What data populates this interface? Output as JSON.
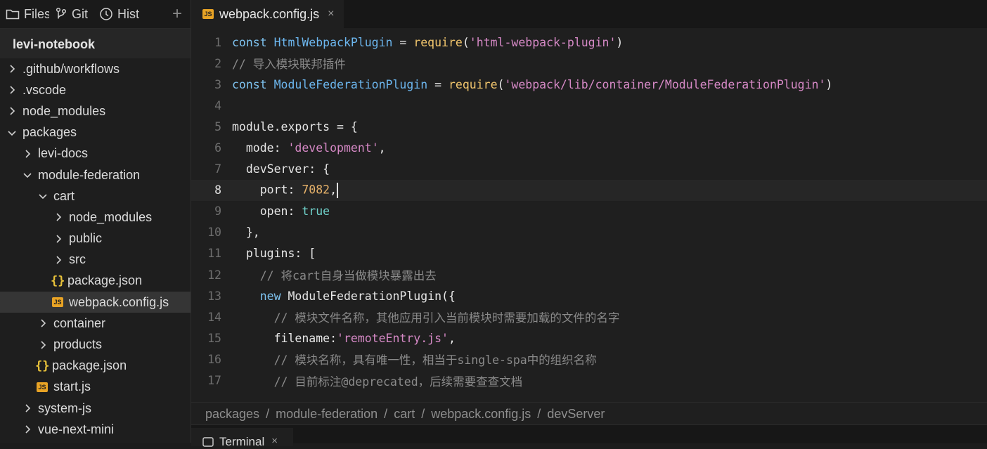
{
  "sidebar": {
    "tabs": [
      {
        "label": "Files",
        "icon": "folder-icon"
      },
      {
        "label": "Git",
        "icon": "git-branch-icon"
      },
      {
        "label": "Hist",
        "icon": "clock-icon"
      }
    ],
    "add_label": "+",
    "project": "levi-notebook",
    "tree": [
      {
        "label": ".github/workflows",
        "kind": "folder",
        "expanded": false,
        "depth": 0
      },
      {
        "label": ".vscode",
        "kind": "folder",
        "expanded": false,
        "depth": 0
      },
      {
        "label": "node_modules",
        "kind": "folder",
        "expanded": false,
        "depth": 0
      },
      {
        "label": "packages",
        "kind": "folder",
        "expanded": true,
        "depth": 0
      },
      {
        "label": "levi-docs",
        "kind": "folder",
        "expanded": false,
        "depth": 1
      },
      {
        "label": "module-federation",
        "kind": "folder",
        "expanded": true,
        "depth": 1
      },
      {
        "label": "cart",
        "kind": "folder",
        "expanded": true,
        "depth": 2
      },
      {
        "label": "node_modules",
        "kind": "folder",
        "expanded": false,
        "depth": 3
      },
      {
        "label": "public",
        "kind": "folder",
        "expanded": false,
        "depth": 3
      },
      {
        "label": "src",
        "kind": "folder",
        "expanded": false,
        "depth": 3
      },
      {
        "label": "package.json",
        "kind": "json",
        "depth": 3
      },
      {
        "label": "webpack.config.js",
        "kind": "js",
        "depth": 3,
        "selected": true
      },
      {
        "label": "container",
        "kind": "folder",
        "expanded": false,
        "depth": 2
      },
      {
        "label": "products",
        "kind": "folder",
        "expanded": false,
        "depth": 2
      },
      {
        "label": "package.json",
        "kind": "json",
        "depth": 2
      },
      {
        "label": "start.js",
        "kind": "js",
        "depth": 2
      },
      {
        "label": "system-js",
        "kind": "folder",
        "expanded": false,
        "depth": 1
      },
      {
        "label": "vue-next-mini",
        "kind": "folder",
        "expanded": false,
        "depth": 1
      }
    ]
  },
  "editor": {
    "tab": {
      "label": "webpack.config.js",
      "badge": "JS",
      "close": "×"
    },
    "current_line": 8,
    "lines": [
      {
        "n": "1",
        "tokens": [
          [
            "kw",
            "const "
          ],
          [
            "cls",
            "HtmlWebpackPlugin"
          ],
          [
            "src",
            " = "
          ],
          [
            "fn",
            "require"
          ],
          [
            "src",
            "("
          ],
          [
            "str",
            "'html-webpack-plugin'"
          ],
          [
            "src",
            ")"
          ]
        ]
      },
      {
        "n": "2",
        "tokens": [
          [
            "cm",
            "// 导入模块联邦插件"
          ]
        ]
      },
      {
        "n": "3",
        "tokens": [
          [
            "kw",
            "const "
          ],
          [
            "cls",
            "ModuleFederationPlugin"
          ],
          [
            "src",
            " = "
          ],
          [
            "fn",
            "require"
          ],
          [
            "src",
            "("
          ],
          [
            "str",
            "'webpack/lib/container/ModuleFederationPlugin'"
          ],
          [
            "src",
            ")"
          ]
        ]
      },
      {
        "n": "4",
        "tokens": []
      },
      {
        "n": "5",
        "tokens": [
          [
            "src",
            "module.exports = {"
          ]
        ]
      },
      {
        "n": "6",
        "tokens": [
          [
            "src",
            "  mode: "
          ],
          [
            "str",
            "'development'"
          ],
          [
            "src",
            ","
          ]
        ]
      },
      {
        "n": "7",
        "tokens": [
          [
            "src",
            "  devServer: {"
          ]
        ]
      },
      {
        "n": "8",
        "tokens": [
          [
            "src",
            "    port: "
          ],
          [
            "num",
            "7082"
          ],
          [
            "src",
            ","
          ]
        ],
        "cursor": true
      },
      {
        "n": "9",
        "tokens": [
          [
            "src",
            "    open: "
          ],
          [
            "bool",
            "true"
          ]
        ]
      },
      {
        "n": "10",
        "tokens": [
          [
            "src",
            "  },"
          ]
        ]
      },
      {
        "n": "11",
        "tokens": [
          [
            "src",
            "  plugins: ["
          ]
        ]
      },
      {
        "n": "12",
        "tokens": [
          [
            "cm",
            "    // 将cart自身当做模块暴露出去"
          ]
        ]
      },
      {
        "n": "13",
        "tokens": [
          [
            "kw",
            "    new "
          ],
          [
            "src",
            "ModuleFederationPlugin({"
          ]
        ]
      },
      {
        "n": "14",
        "tokens": [
          [
            "cm",
            "      // 模块文件名称，其他应用引入当前模块时需要加载的文件的名字"
          ]
        ]
      },
      {
        "n": "15",
        "tokens": [
          [
            "src",
            "      filename:"
          ],
          [
            "str",
            "'remoteEntry.js'"
          ],
          [
            "src",
            ","
          ]
        ]
      },
      {
        "n": "16",
        "tokens": [
          [
            "cm",
            "      // 模块名称，具有唯一性，相当于single-spa中的组织名称"
          ]
        ]
      },
      {
        "n": "17",
        "tokens": [
          [
            "cm",
            "      // 目前标注@deprecated，后续需要查查文档"
          ]
        ]
      }
    ]
  },
  "breadcrumb": [
    "packages",
    "module-federation",
    "cart",
    "webpack.config.js",
    "devServer"
  ],
  "breadcrumb_sep": "/",
  "terminal": {
    "label": "Terminal",
    "close": "×"
  }
}
